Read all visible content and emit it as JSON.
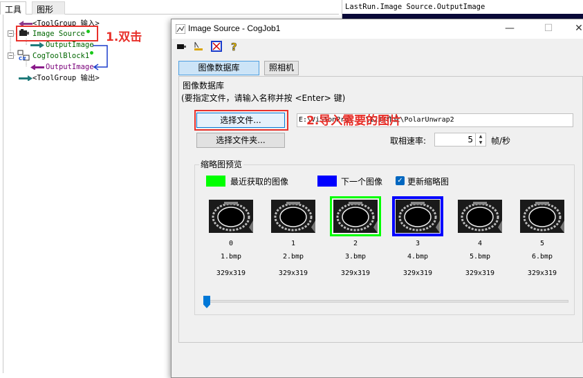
{
  "left": {
    "tabs": [
      "工具",
      "图形"
    ],
    "tree": {
      "toolgroup_in": "<ToolGroup 输入>",
      "image_source": "Image Source",
      "output_image_1": "OutputImage",
      "toolblock": "CogToolBlock1",
      "output_image_2": "OutputImage",
      "toolgroup_out": "<ToolGroup 输出>"
    },
    "annotation_1": "1.双击"
  },
  "output_pane": {
    "title": "LastRun.Image Source.OutputImage"
  },
  "dialog": {
    "title": "Image Source - CogJob1",
    "window_buttons": {
      "minimize": "—",
      "maximize": "☐",
      "close": "✕"
    },
    "tabs": [
      "图像数据库",
      "照相机"
    ],
    "group_label": "图像数据库",
    "hint": "(要指定文件，请输入名称并按 <Enter> 键)",
    "select_file_button": "选择文件...",
    "select_folder_button": "选择文件夹...",
    "path_value": "E:\\ViSionPro\\...\\1231作业\\PolarUnwrap2",
    "annotation_2": "2.导入需要的图片",
    "rate_label": "取相速率:",
    "rate_value": "5",
    "rate_unit": "帧/秒",
    "thumb_group_label": "缩略图预览",
    "legend": {
      "recent": "最近获取的图像",
      "next": "下一个图像",
      "update": "更新缩略图",
      "recent_color": "#00ff00",
      "next_color": "#0000ff"
    },
    "thumbnails": [
      {
        "index": "0",
        "name": "1.bmp",
        "size": "329x319"
      },
      {
        "index": "1",
        "name": "2.bmp",
        "size": "329x319"
      },
      {
        "index": "2",
        "name": "3.bmp",
        "size": "329x319"
      },
      {
        "index": "3",
        "name": "4.bmp",
        "size": "329x319"
      },
      {
        "index": "4",
        "name": "5.bmp",
        "size": "329x319"
      },
      {
        "index": "5",
        "name": "6.bmp",
        "size": "329x319"
      }
    ],
    "slider_position": 0
  }
}
